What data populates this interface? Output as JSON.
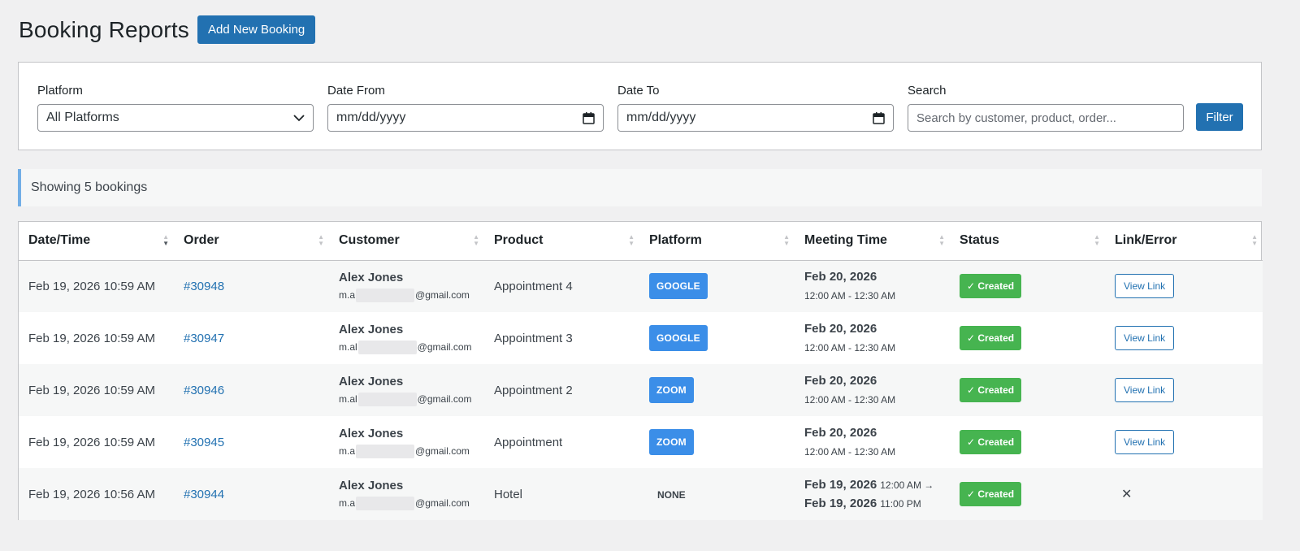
{
  "header": {
    "title": "Booking Reports",
    "add_button": "Add New Booking"
  },
  "filters": {
    "platform_label": "Platform",
    "platform_value": "All Platforms",
    "date_from_label": "Date From",
    "date_from_placeholder": "mm/dd/yyyy",
    "date_to_label": "Date To",
    "date_to_placeholder": "mm/dd/yyyy",
    "search_label": "Search",
    "search_placeholder": "Search by customer, product, order...",
    "filter_button": "Filter"
  },
  "notice": "Showing 5 bookings",
  "table": {
    "columns": [
      "Date/Time",
      "Order",
      "Customer",
      "Product",
      "Platform",
      "Meeting Time",
      "Status",
      "Link/Error"
    ],
    "rows": [
      {
        "datetime": "Feb 19, 2026 10:59 AM",
        "order": "#30948",
        "customer_name": "Alex Jones",
        "email_prefix": "m.a",
        "email_suffix": "@gmail.com",
        "product": "Appointment 4",
        "platform": "GOOGLE",
        "meeting_date": "Feb 20, 2026",
        "meeting_time": "12:00 AM - 12:30 AM",
        "status": "✓ Created",
        "link": "View Link"
      },
      {
        "datetime": "Feb 19, 2026 10:59 AM",
        "order": "#30947",
        "customer_name": "Alex Jones",
        "email_prefix": "m.al",
        "email_suffix": "@gmail.com",
        "product": "Appointment 3",
        "platform": "GOOGLE",
        "meeting_date": "Feb 20, 2026",
        "meeting_time": "12:00 AM - 12:30 AM",
        "status": "✓ Created",
        "link": "View Link"
      },
      {
        "datetime": "Feb 19, 2026 10:59 AM",
        "order": "#30946",
        "customer_name": "Alex Jones",
        "email_prefix": "m.al",
        "email_suffix": "@gmail.com",
        "product": "Appointment 2",
        "platform": "ZOOM",
        "meeting_date": "Feb 20, 2026",
        "meeting_time": "12:00 AM - 12:30 AM",
        "status": "✓ Created",
        "link": "View Link"
      },
      {
        "datetime": "Feb 19, 2026 10:59 AM",
        "order": "#30945",
        "customer_name": "Alex Jones",
        "email_prefix": "m.a",
        "email_suffix": "@gmail.com",
        "product": "Appointment",
        "platform": "ZOOM",
        "meeting_date": "Feb 20, 2026",
        "meeting_time": "12:00 AM - 12:30 AM",
        "status": "✓ Created",
        "link": "View Link"
      },
      {
        "datetime": "Feb 19, 2026 10:56 AM",
        "order": "#30944",
        "customer_name": "Alex Jones",
        "email_prefix": "m.a",
        "email_suffix": "@gmail.com",
        "product": "Hotel",
        "platform": "NONE",
        "meeting_start_date": "Feb 19, 2026",
        "meeting_start_time": "12:00 AM →",
        "meeting_end_date": "Feb 19, 2026",
        "meeting_end_time": "11:00 PM",
        "status": "✓ Created",
        "link_error": "✕"
      }
    ]
  },
  "colors": {
    "primary": "#2271b1",
    "platform_badge": "#3b8ee8",
    "status_created": "#46b450",
    "notice_border": "#72aee6"
  }
}
